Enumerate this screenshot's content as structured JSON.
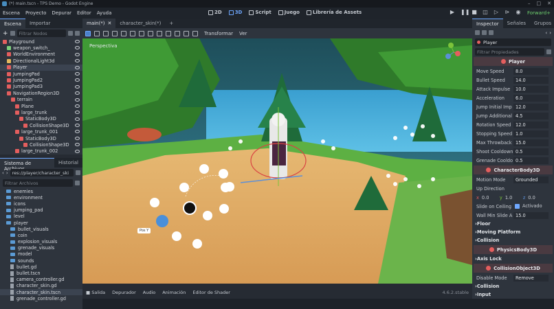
{
  "window": {
    "title": "(*) main.tscn - TPS Demo - Godot Engine"
  },
  "menu": [
    "Escena",
    "Proyecto",
    "Depurar",
    "Editor",
    "Ayuda"
  ],
  "workspaces": [
    "2D",
    "3D",
    "Script",
    "Juego",
    "Librería de Assets"
  ],
  "renderer": "Forward+",
  "scene_dock": {
    "tabs": [
      "Escena",
      "Importar"
    ],
    "filter_placeholder": "Filtrar Nodos",
    "nodes": [
      {
        "name": "Playground",
        "level": 0,
        "color": "#e45e5e"
      },
      {
        "name": "weapon_switch_",
        "level": 1,
        "color": "#7cd07c"
      },
      {
        "name": "WorldEnvironment",
        "level": 1,
        "color": "#e45e5e"
      },
      {
        "name": "DirectionalLight3d",
        "level": 1,
        "color": "#e4b85e"
      },
      {
        "name": "Player",
        "level": 1,
        "color": "#e45e5e"
      },
      {
        "name": "JumpingPad",
        "level": 1,
        "color": "#e45e5e"
      },
      {
        "name": "JumpingPad2",
        "level": 1,
        "color": "#e45e5e"
      },
      {
        "name": "JumpingPad3",
        "level": 1,
        "color": "#e45e5e"
      },
      {
        "name": "NavigationRegion3D",
        "level": 1,
        "color": "#e45e5e"
      },
      {
        "name": "terrain",
        "level": 2,
        "color": "#e45e5e"
      },
      {
        "name": "Plane",
        "level": 3,
        "color": "#e45e5e"
      },
      {
        "name": "large_trunk",
        "level": 3,
        "color": "#e45e5e"
      },
      {
        "name": "StaticBody3D",
        "level": 4,
        "color": "#e45e5e"
      },
      {
        "name": "CollisionShape3D",
        "level": 5,
        "color": "#e45e5e"
      },
      {
        "name": "large_trunk_001",
        "level": 3,
        "color": "#e45e5e"
      },
      {
        "name": "StaticBody3D",
        "level": 4,
        "color": "#e45e5e"
      },
      {
        "name": "CollisionShape3D",
        "level": 5,
        "color": "#e45e5e"
      },
      {
        "name": "large_trunk_002",
        "level": 3,
        "color": "#e45e5e"
      }
    ]
  },
  "fs_dock": {
    "tabs": [
      "Sistema de Archivos",
      "Historial"
    ],
    "path": "res://player/character_ski",
    "filter_placeholder": "Filtrar Archivos",
    "items": [
      {
        "name": "enemies",
        "type": "folder",
        "level": 1
      },
      {
        "name": "environment",
        "type": "folder",
        "level": 1
      },
      {
        "name": "icons",
        "type": "folder",
        "level": 1
      },
      {
        "name": "jumping_pad",
        "type": "folder",
        "level": 1
      },
      {
        "name": "level",
        "type": "folder",
        "level": 1
      },
      {
        "name": "player",
        "type": "folder",
        "level": 1
      },
      {
        "name": "bullet_visuals",
        "type": "folder",
        "level": 2
      },
      {
        "name": "coin",
        "type": "folder",
        "level": 2
      },
      {
        "name": "explosion_visuals",
        "type": "folder",
        "level": 2
      },
      {
        "name": "grenade_visuals",
        "type": "folder",
        "level": 2
      },
      {
        "name": "model",
        "type": "folder",
        "level": 2
      },
      {
        "name": "sounds",
        "type": "folder",
        "level": 2
      },
      {
        "name": "bullet.gd",
        "type": "file",
        "level": 2
      },
      {
        "name": "bullet.tscn",
        "type": "file",
        "level": 2
      },
      {
        "name": "camera_controller.gd",
        "type": "file",
        "level": 2
      },
      {
        "name": "character_skin.gd",
        "type": "file",
        "level": 2
      },
      {
        "name": "character_skin.tscn",
        "type": "file",
        "level": 2
      },
      {
        "name": "grenade_controller.gd",
        "type": "file",
        "level": 2
      }
    ]
  },
  "editor_tabs": [
    {
      "label": "main(*)",
      "active": true
    },
    {
      "label": "character_skin(*)",
      "active": false
    }
  ],
  "viewport": {
    "toolbar": [
      "Transformar",
      "Ver"
    ],
    "label": "Perspectiva",
    "gizmo_label": "Pos Y"
  },
  "bottom_tabs": [
    "Salida",
    "Depurador",
    "Audio",
    "Animación",
    "Editor de Shader"
  ],
  "version": "4.6.2.stable",
  "inspector": {
    "tabs": [
      "Inspector",
      "Señales",
      "Grupos"
    ],
    "node": "Player",
    "filter_placeholder": "Filtrar Propiedades",
    "section": "Player",
    "props": [
      {
        "label": "Move Speed",
        "value": "8.0"
      },
      {
        "label": "Bullet Speed",
        "value": "14.0"
      },
      {
        "label": "Attack Impulse",
        "value": "10.0"
      },
      {
        "label": "Acceleration",
        "value": "6.0"
      },
      {
        "label": "Jump Initial Imp",
        "value": "12.0"
      },
      {
        "label": "Jump Additional",
        "value": "4.5"
      },
      {
        "label": "Rotation Speed",
        "value": "12.0"
      },
      {
        "label": "Stopping Speed",
        "value": "1.0"
      },
      {
        "label": "Max Throwback",
        "value": "15.0"
      },
      {
        "label": "Shoot Cooldown",
        "value": "0.5"
      },
      {
        "label": "Grenade Cooldo",
        "value": "0.5"
      }
    ],
    "cb_section": "CharacterBody3D",
    "motion_mode": {
      "label": "Motion Mode",
      "value": "Grounded"
    },
    "up_direction": {
      "label": "Up Direction",
      "x": "0.0",
      "y": "1.0",
      "z": "0.0"
    },
    "slide_on_ceiling": {
      "label": "Slide on Ceiling",
      "value": "Activado"
    },
    "wall_min_slide": {
      "label": "Wall Min Slide A",
      "value": "15.0"
    },
    "groups": [
      "Floor",
      "Moving Platform",
      "Collision"
    ],
    "pb_section": "PhysicsBody3D",
    "axis_lock": "Axis Lock",
    "co_section": "CollisionObject3D",
    "disable_mode": {
      "label": "Disable Mode",
      "value": "Remove"
    },
    "groups2": [
      "Collision",
      "Input"
    ]
  }
}
